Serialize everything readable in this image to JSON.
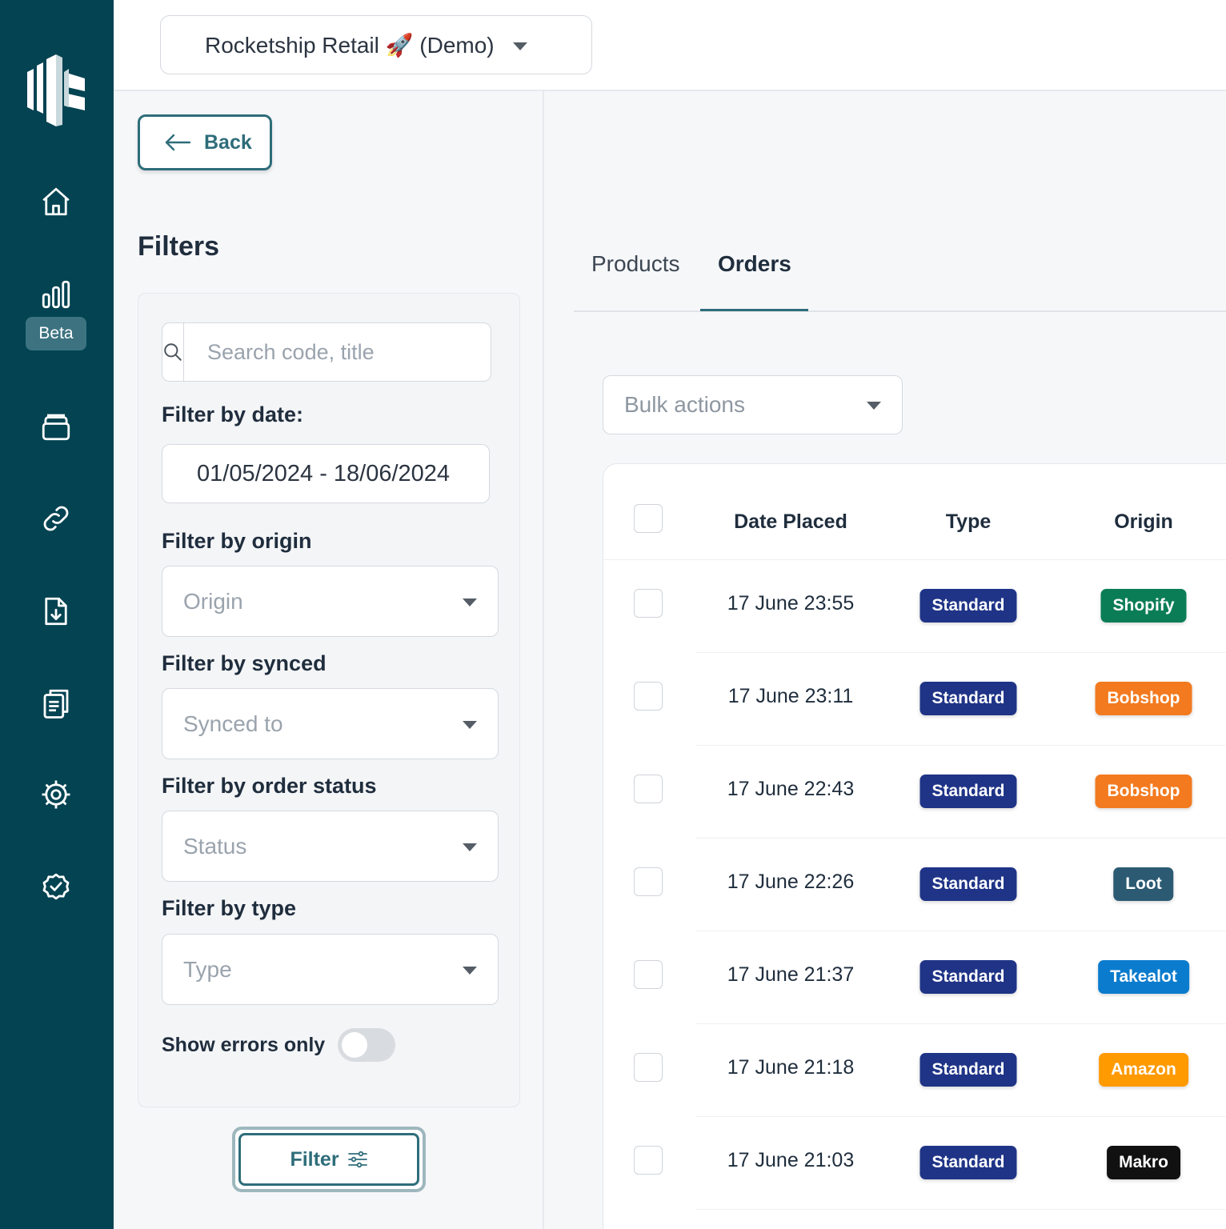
{
  "header": {
    "store_selector": "Rocketship Retail 🚀 (Demo)"
  },
  "sidebar": {
    "beta_label": "Beta",
    "icons": [
      "home-icon",
      "bar-chart-icon",
      "inventory-icon",
      "link-icon",
      "file-download-icon",
      "clipboard-icon",
      "settings-icon",
      "check-circle-icon"
    ]
  },
  "left_panel": {
    "back_label": "Back",
    "title": "Filters",
    "search_placeholder": "Search code, title",
    "date_label": "Filter by date:",
    "date_value": "01/05/2024 - 18/06/2024",
    "origin_label": "Filter by origin",
    "origin_placeholder": "Origin",
    "synced_label": "Filter by synced",
    "synced_placeholder": "Synced to",
    "status_label": "Filter by order status",
    "status_placeholder": "Status",
    "type_label": "Filter by type",
    "type_placeholder": "Type",
    "errors_label": "Show errors only",
    "errors_enabled": false,
    "filter_button": "Filter"
  },
  "main": {
    "tabs": [
      {
        "label": "Products",
        "active": false
      },
      {
        "label": "Orders",
        "active": true
      }
    ],
    "bulk_actions_placeholder": "Bulk actions",
    "table": {
      "columns": [
        "Date Placed",
        "Type",
        "Origin"
      ],
      "rows": [
        {
          "date": "17 June 23:55",
          "type": "Standard",
          "origin": "Shopify"
        },
        {
          "date": "17 June 23:11",
          "type": "Standard",
          "origin": "Bobshop"
        },
        {
          "date": "17 June 22:43",
          "type": "Standard",
          "origin": "Bobshop"
        },
        {
          "date": "17 June 22:26",
          "type": "Standard",
          "origin": "Loot"
        },
        {
          "date": "17 June 21:37",
          "type": "Standard",
          "origin": "Takealot"
        },
        {
          "date": "17 June 21:18",
          "type": "Standard",
          "origin": "Amazon"
        },
        {
          "date": "17 June 21:03",
          "type": "Standard",
          "origin": "Makro"
        }
      ]
    }
  },
  "colors": {
    "sidebar_bg": "#034352",
    "accent": "#2e6d7a",
    "type_standard": "#1f3487",
    "origin_shopify": "#0a7d57",
    "origin_bobshop": "#f37a1f",
    "origin_loot": "#2c5a73",
    "origin_takealot": "#0b7ccd",
    "origin_amazon": "#ff9a00",
    "origin_makro": "#111111"
  }
}
